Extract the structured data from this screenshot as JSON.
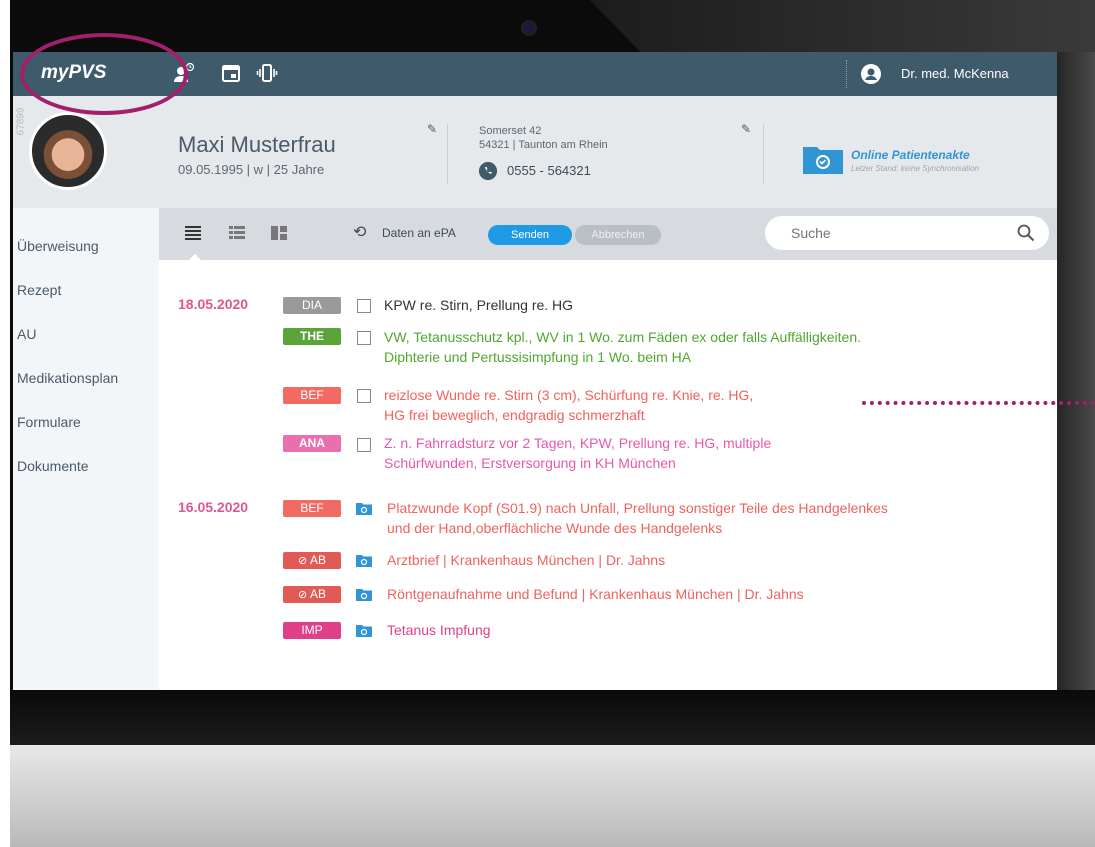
{
  "app": {
    "name": "myPVS",
    "user": "Dr. med. McKenna"
  },
  "patient": {
    "id": "67899",
    "name": "Maxi Musterfrau",
    "info": "09.05.1995 | w | 25 Jahre",
    "street": "Somerset 42",
    "city": "54321 | Taunton am Rhein",
    "phone": "0555 - 564321"
  },
  "epa": {
    "title": "Online Patientenakte",
    "subtitle": "Letzer Stand: keine Synchronisation"
  },
  "sidebar": {
    "items": [
      "Überweisung",
      "Rezept",
      "AU",
      "Medikationsplan",
      "Formulare",
      "Dokumente"
    ]
  },
  "toolbar": {
    "sync_label": "Daten an ePA",
    "send": "Senden",
    "cancel": "Abbrechen",
    "search_placeholder": "Suche"
  },
  "colors": {
    "topbar": "#3e5a6b",
    "accent": "#1f9be6",
    "date": "#e0578f",
    "DIA": "#9a9a9a",
    "THE": "#5aa43a",
    "BEF": "#f26b63",
    "ANA": "#ea6fae",
    "AB": "#e05b55",
    "IMP": "#e0408a"
  },
  "entries": {
    "d1": "18.05.2020",
    "d2": "16.05.2020",
    "e1": {
      "tag": "DIA",
      "l1": "KPW re. Stirn, Prellung re. HG"
    },
    "e2": {
      "tag": "THE",
      "l1": "VW, Tetanusschutz kpl., WV in 1 Wo. zum Fäden ex oder falls Auffälligkeiten.",
      "l2": "Diphterie und Pertussisimpfung in 1 Wo. beim HA"
    },
    "e3": {
      "tag": "BEF",
      "l1": "reizlose Wunde re. Stirn (3 cm), Schürfung re. Knie, re. HG,",
      "l2": "HG frei beweglich, endgradig schmerzhaft"
    },
    "e4": {
      "tag": "ANA",
      "l1": "Z. n. Fahrradsturz vor 2 Tagen, KPW, Prellung re. HG, multiple",
      "l2": "Schürfwunden, Erstversorgung in KH München"
    },
    "e5": {
      "tag": "BEF",
      "l1": "Platzwunde Kopf (S01.9) nach Unfall, Prellung sonstiger Teile des Handgelenkes",
      "l2": "und der Hand,oberflächliche Wunde des Handgelenks"
    },
    "e6": {
      "tag": "AB",
      "l1": "Arztbrief | Krankenhaus München | Dr. Jahns"
    },
    "e7": {
      "tag": "AB",
      "l1": "Röntgenaufnahme und Befund | Krankenhaus München | Dr. Jahns"
    },
    "e8": {
      "tag": "IMP",
      "l1": "Tetanus Impfung"
    }
  }
}
